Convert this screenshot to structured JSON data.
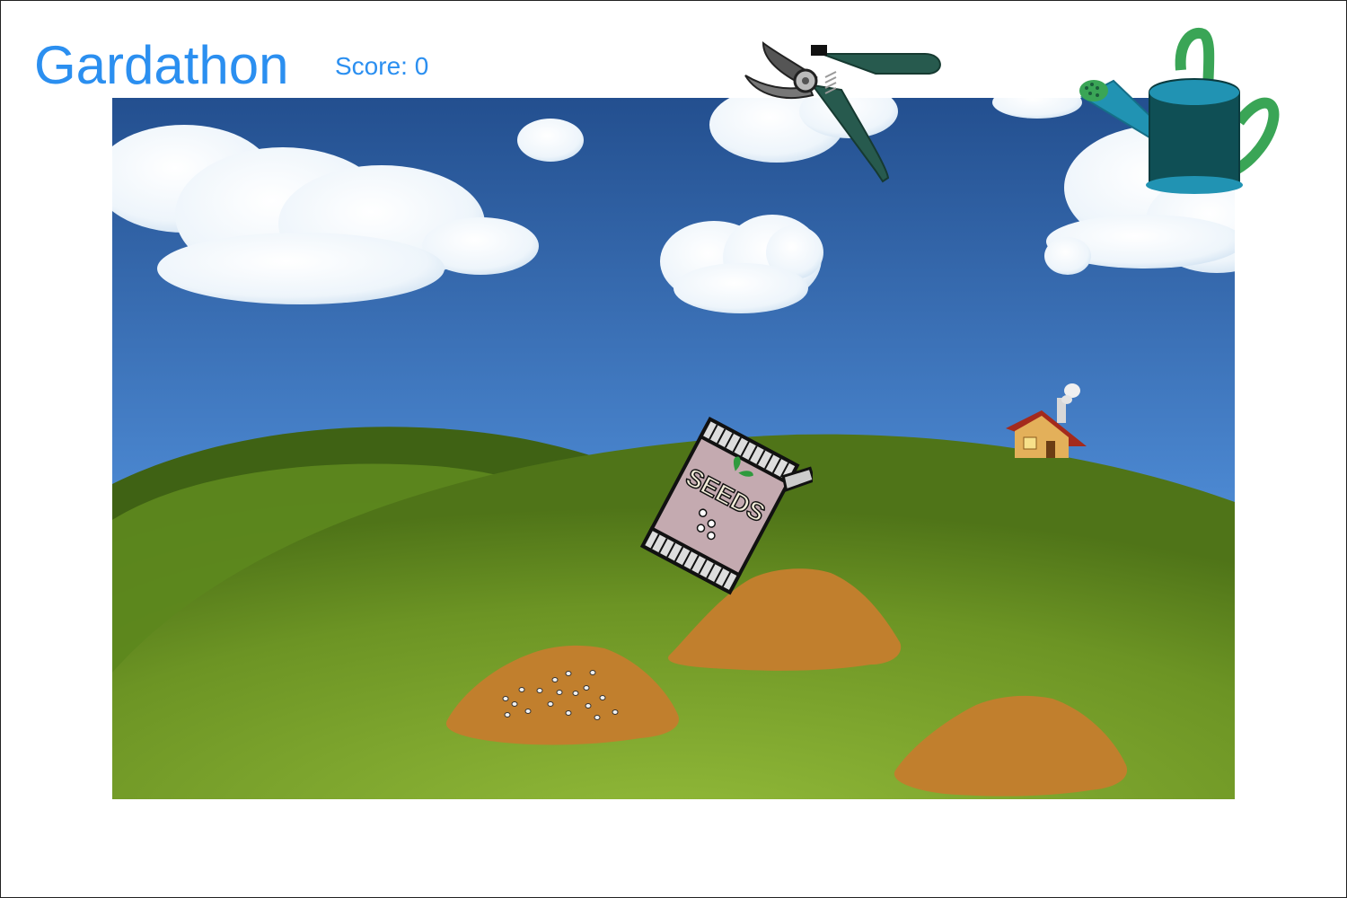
{
  "header": {
    "title": "Gardathon",
    "score_label": "Score:",
    "score_value": "0"
  },
  "tools": {
    "pruners_icon": "pruning-shears-icon",
    "watering_can_icon": "watering-can-icon",
    "seed_packet_label": "SEEDS"
  },
  "plots": [
    {
      "state": "empty"
    },
    {
      "state": "seeded"
    },
    {
      "state": "empty"
    }
  ],
  "colors": {
    "title": "#2b8ff0",
    "sky_top": "#234f8f",
    "sky_bottom": "#6aa6e6",
    "hill": "#6f9a25",
    "soil": "#c17f2d"
  }
}
